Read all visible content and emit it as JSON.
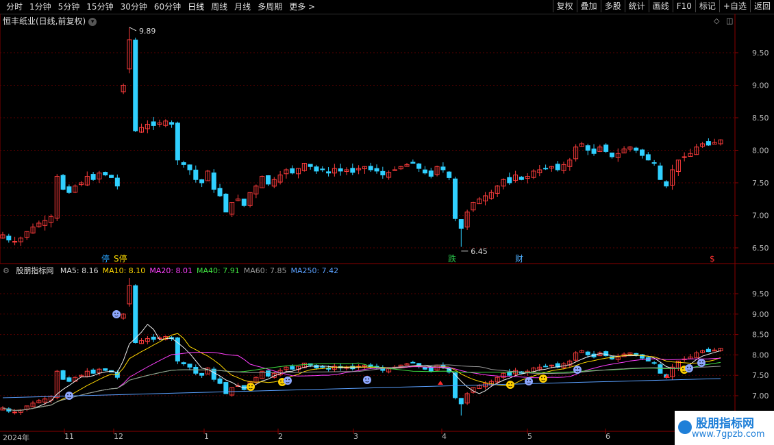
{
  "toolbar": {
    "periods": [
      "分时",
      "1分钟",
      "5分钟",
      "15分钟",
      "30分钟",
      "60分钟",
      "日线",
      "周线",
      "月线",
      "多周期",
      "更多 >"
    ],
    "active_period": "日线",
    "right_buttons": [
      "复权",
      "叠加",
      "多股",
      "统计",
      "画线",
      "F10",
      "标记",
      "+自选",
      "返回"
    ]
  },
  "main_chart": {
    "title": "恒丰纸业(日线,前复权)",
    "y_ticks": [
      "9.50",
      "9.00",
      "8.50",
      "8.00",
      "7.50",
      "7.00",
      "6.50"
    ],
    "high_label": "9.89",
    "low_label": "6.45",
    "markers": [
      {
        "text": "停",
        "color": "#29a3ff"
      },
      {
        "text": "S停",
        "color": "#ffdc00"
      },
      {
        "text": "跌",
        "color": "#29c34a"
      },
      {
        "text": "财",
        "color": "#4fb0ff"
      },
      {
        "text": "$",
        "color": "#ff3030"
      }
    ]
  },
  "indicator": {
    "name": "股朋指标网",
    "ma": [
      {
        "label": "MA5: 8.16",
        "color": "#dddddd"
      },
      {
        "label": "MA10: 8.10",
        "color": "#ffd800"
      },
      {
        "label": "MA20: 8.01",
        "color": "#ff40ff"
      },
      {
        "label": "MA40: 7.91",
        "color": "#40e040"
      },
      {
        "label": "MA60: 7.85",
        "color": "#999999"
      },
      {
        "label": "MA250: 7.42",
        "color": "#5aa0ff"
      }
    ],
    "y_ticks": [
      "9.50",
      "9.00",
      "8.50",
      "8.00",
      "7.50",
      "7.00"
    ]
  },
  "x_axis": {
    "labels": [
      "2024年",
      "11",
      "12",
      "1",
      "2",
      "3",
      "4",
      "5",
      "6"
    ]
  },
  "watermark": {
    "title": "股朋指标网",
    "url": "www.7gpzb.com"
  },
  "chart_data": {
    "type": "candlestick",
    "y_range": [
      6.3,
      9.95
    ],
    "price_path": [
      6.7,
      6.62,
      6.6,
      6.65,
      6.75,
      6.82,
      6.88,
      6.92,
      6.98,
      7.6,
      7.4,
      7.35,
      7.45,
      7.5,
      7.6,
      7.55,
      7.65,
      7.62,
      7.58,
      7.45,
      9.0,
      9.7,
      8.3,
      8.35,
      8.4,
      8.38,
      8.42,
      8.45,
      8.4,
      7.85,
      7.78,
      7.7,
      7.55,
      7.5,
      7.68,
      7.4,
      7.3,
      7.05,
      7.2,
      7.25,
      7.15,
      7.35,
      7.45,
      7.6,
      7.48,
      7.55,
      7.62,
      7.7,
      7.65,
      7.72,
      7.8,
      7.75,
      7.68,
      7.7,
      7.65,
      7.72,
      7.68,
      7.7,
      7.66,
      7.72,
      7.75,
      7.7,
      7.68,
      7.62,
      7.66,
      7.7,
      7.75,
      7.78,
      7.8,
      7.72,
      7.65,
      7.6,
      7.75,
      7.7,
      7.58,
      6.95,
      6.8,
      7.05,
      7.2,
      7.25,
      7.3,
      7.35,
      7.45,
      7.55,
      7.5,
      7.62,
      7.55,
      7.6,
      7.68,
      7.7,
      7.72,
      7.75,
      7.7,
      7.78,
      7.85,
      8.05,
      8.1,
      8.0,
      7.95,
      8.05,
      7.98,
      7.9,
      7.95,
      8.02,
      8.05,
      8.0,
      7.92,
      7.85,
      7.8,
      7.55,
      7.45,
      7.7,
      7.85,
      7.9,
      7.95,
      8.05,
      8.1,
      8.08,
      8.12,
      8.16
    ]
  }
}
